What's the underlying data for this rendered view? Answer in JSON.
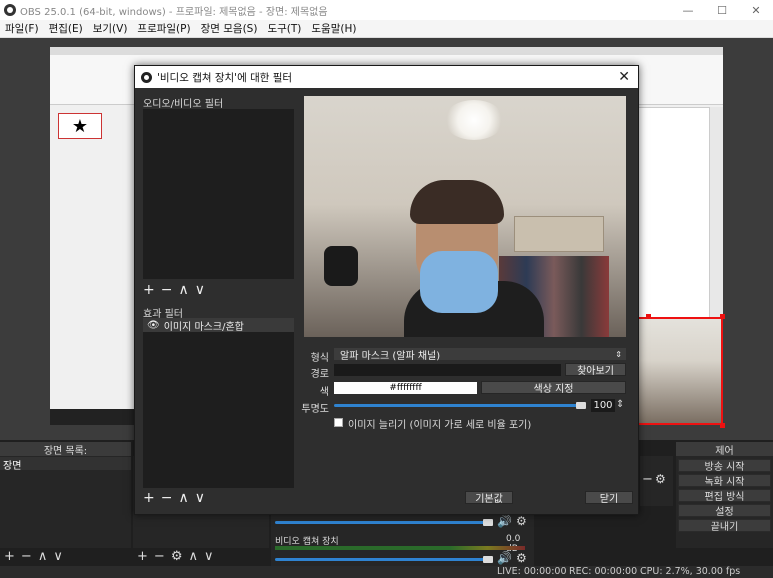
{
  "window": {
    "title": "OBS 25.0.1 (64-bit, windows) - 프로파일: 제목없음 - 장면: 제목없음",
    "minimize": "—",
    "maximize": "☐",
    "close": "✕"
  },
  "menu": [
    "파일(F)",
    "편집(E)",
    "보기(V)",
    "프로파일(P)",
    "장면 모음(S)",
    "도구(T)",
    "도움말(H)"
  ],
  "docks": {
    "scenes_header": "장면 목록:",
    "scene_item": "장면",
    "controls_header": "제어",
    "controls": [
      "방송 시작",
      "녹화 시작",
      "편집 방식",
      "설정",
      "끝내기"
    ]
  },
  "mixer": {
    "source_name": "비디오 캡쳐 장치",
    "level": "0.0 dB"
  },
  "status": {
    "live": "LIVE: 00:00:00",
    "rec": "REC: 00:00:00",
    "cpu": "CPU: 2.7%, 30.00 fps"
  },
  "preview_slide_glyph": "★",
  "dialog": {
    "title": "'비디오 캡쳐 장치'에 대한 필터",
    "close": "✕",
    "av_filters_label": "오디오/비디오 필터",
    "effect_filters_label": "효과 필터",
    "effect_filter_items": [
      "이미지 마스크/혼합"
    ],
    "form": {
      "type_label": "형식",
      "type_value": "알파 마스크 (알파 채널)",
      "path_label": "경로",
      "browse_button": "찾아보기",
      "color_label": "색",
      "color_value": "#ffffffff",
      "color_button": "색상 지정",
      "opacity_label": "투명도",
      "opacity_value": "100",
      "stretch_label": "이미지 늘리기 (이미지 가로 세로 비율 포기)"
    },
    "defaults_button": "기본값",
    "close_button": "닫기"
  },
  "colors": {
    "accent": "#2f83d0",
    "selection": "#ee1111"
  }
}
